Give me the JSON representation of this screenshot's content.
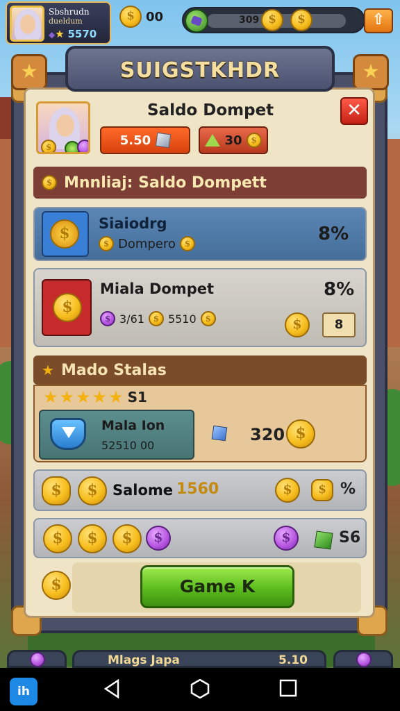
{
  "hud": {
    "player_name": "Sbshrudn",
    "player_sub": "dueldum",
    "star_value": "5570",
    "coin_value": "00",
    "progress_value": "309"
  },
  "panel": {
    "title": "SUIGSTKHDR",
    "header_title": "Saldo Dompet",
    "balance_value": "5.50",
    "gems_value": "30",
    "close_symbol": "✕"
  },
  "section1": {
    "heading": "Mnnliaj: Saldo Dompett",
    "row1": {
      "title": "Siaiodrg",
      "sub": "Dompero",
      "pct": "8%"
    },
    "row2": {
      "title": "Miala Dompet",
      "sub_a": "3/61",
      "sub_b": "5510",
      "pct": "8%",
      "button": "8"
    }
  },
  "section2": {
    "heading": "Mado Stalas",
    "stars_value": "S1",
    "quest_title": "Mala Ion",
    "quest_sub": "52510 00",
    "quest_reward": "320"
  },
  "rows_bottom": {
    "saloone_label": "Salome",
    "saloone_value": "1560",
    "saloone_right": "%",
    "coins_right": "S6"
  },
  "cta": {
    "label": "Game K"
  },
  "bottom_cards": {
    "middle_label": "Mlags Japa",
    "middle_value": "5.10"
  },
  "colors": {
    "accent_orange": "#ff6a2a",
    "cta_green": "#5cbd1e",
    "close_red": "#c42214",
    "coin_gold": "#f7be1e",
    "section_maroon": "#7d3e36"
  },
  "icons": [
    "avatar",
    "gold-coin",
    "purple-coin",
    "shield-icon",
    "cube-icon",
    "close-icon",
    "back-icon",
    "home-icon",
    "recents-icon"
  ]
}
